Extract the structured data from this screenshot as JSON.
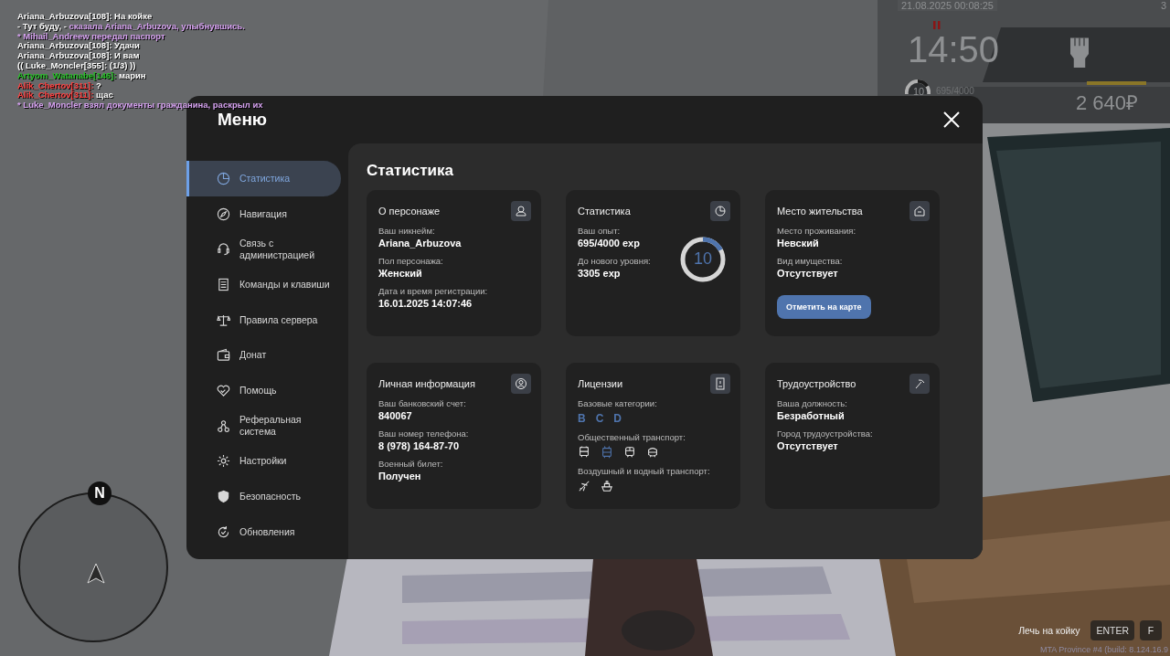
{
  "chat": [
    {
      "parts": [
        {
          "text": "Ariana_Arbuzova[108]: На койке",
          "color": "#ffffff"
        }
      ]
    },
    {
      "parts": [
        {
          "text": "- Тут буду, - ",
          "color": "#ffffff"
        },
        {
          "text": "сказала Ariana_Arbuzova, улыбнувшись.",
          "color": "#d6a2f0"
        }
      ]
    },
    {
      "parts": [
        {
          "text": "* Mihail_Andreew передал паспорт",
          "color": "#d6a2f0"
        }
      ]
    },
    {
      "parts": [
        {
          "text": "Ariana_Arbuzova[108]: Удачи",
          "color": "#ffffff"
        }
      ]
    },
    {
      "parts": [
        {
          "text": "Ariana_Arbuzova[108]: И вам",
          "color": "#ffffff"
        }
      ]
    },
    {
      "parts": [
        {
          "text": "(( Luke_Moncler[355]: (1/3) ))",
          "color": "#ffffff"
        }
      ]
    },
    {
      "parts": [
        {
          "text": "Artyom_Watanabe[146]:",
          "color": "#27c227"
        },
        {
          "text": " марин",
          "color": "#ffffff"
        }
      ]
    },
    {
      "parts": [
        {
          "text": "Alik_Chertov[311]:",
          "color": "#ff4040"
        },
        {
          "text": " ?"
        }
      ]
    },
    {
      "parts": [
        {
          "text": "Alik_Chertov[311]:",
          "color": "#ff4040"
        },
        {
          "text": " щас",
          "color": "#ffffff"
        }
      ]
    },
    {
      "parts": [
        {
          "text": "* Luke_Moncler взял документы гражданина, раскрыл их",
          "color": "#d6a2f0"
        }
      ]
    }
  ],
  "hud": {
    "date": "21.08.2025 00:08:25",
    "corner": "3",
    "time": "14:50",
    "level_text": "10",
    "level": 0.17,
    "exp": "695/4000",
    "money": "2 640₽"
  },
  "menu": {
    "title": "Меню",
    "sidebar": [
      {
        "label": "Статистика",
        "selected": true
      },
      {
        "label": "Навигация",
        "selected": false
      },
      {
        "label": "Связь с администрацией",
        "selected": false
      },
      {
        "label": "Команды и клавиши",
        "selected": false
      },
      {
        "label": "Правила сервера",
        "selected": false
      },
      {
        "label": "Донат",
        "selected": false
      },
      {
        "label": "Помощь",
        "selected": false
      },
      {
        "label": "Реферальная система",
        "selected": false
      },
      {
        "label": "Настройки",
        "selected": false
      },
      {
        "label": "Безопасность",
        "selected": false
      },
      {
        "label": "Обновления",
        "selected": false
      }
    ],
    "content_title": "Статистика",
    "cards": [
      {
        "title": "О персонаже",
        "fields": [
          {
            "label": "Ваш никнейм:",
            "value": "Ariana_Arbuzova"
          },
          {
            "label": "Пол персонажа:",
            "value": "Женский"
          },
          {
            "label": "Дата и время регистрации:",
            "value": "16.01.2025 14:07:46"
          }
        ]
      },
      {
        "title": "Статистика",
        "fields": [
          {
            "label": "Ваш опыт:",
            "value": "695/4000 exp"
          },
          {
            "label": "До нового уровня:",
            "value": "3305 exp"
          }
        ],
        "ring": {
          "text": "10",
          "level": 0.17
        }
      },
      {
        "title": "Место жительства",
        "fields": [
          {
            "label": "Место проживания:",
            "value": "Невский"
          },
          {
            "label": "Вид имущества:",
            "value": "Отсутствует"
          }
        ],
        "button": "Отметить на карте"
      },
      {
        "title": "Личная информация",
        "fields": [
          {
            "label": "Ваш банковский счет:",
            "value": "840067"
          },
          {
            "label": "Ваш номер телефона:",
            "value": "8 (978) 164-87-70"
          },
          {
            "label": "Военный билет:",
            "value": "Получен"
          }
        ]
      },
      {
        "title": "Лицензии",
        "groups": [
          {
            "label": "Базовые категории:",
            "items": [
              {
                "text": "B",
                "active": true
              },
              {
                "text": "C",
                "active": true
              },
              {
                "text": "D",
                "active": true
              }
            ]
          },
          {
            "label": "Общественный транспорт:",
            "items": [
              {
                "kind": "bus",
                "active": false
              },
              {
                "kind": "trolleybus",
                "active": true
              },
              {
                "kind": "train",
                "active": false
              },
              {
                "kind": "tram",
                "active": false
              }
            ]
          },
          {
            "label": "Воздушный и водный транспорт:",
            "items": [
              {
                "kind": "plane",
                "active": false
              },
              {
                "kind": "ship",
                "active": false
              }
            ]
          }
        ]
      },
      {
        "title": "Трудоустройство",
        "fields": [
          {
            "label": "Ваша должность:",
            "value": "Безработный"
          },
          {
            "label": "Город трудоустройства:",
            "value": "Отсутствует"
          }
        ]
      }
    ]
  },
  "compass": "N",
  "prompt": {
    "action": "Лечь на койку",
    "keys": [
      "ENTER",
      "F"
    ]
  },
  "build": "MTA Province #4 (build: 8.124.16.9"
}
